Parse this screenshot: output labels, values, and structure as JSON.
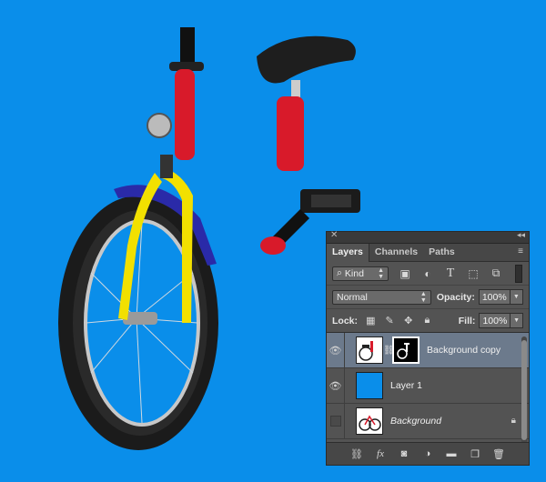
{
  "colors": {
    "background": "#0a8eea",
    "panel": "#535353",
    "selected_layer": "#6c7a8c"
  },
  "panel": {
    "close_glyph": "✕",
    "collapse_glyph": "◂◂",
    "tabs": [
      "Layers",
      "Channels",
      "Paths"
    ],
    "menu_glyph": "≡",
    "filter": {
      "kind_label": "Kind",
      "icons": [
        "image-filter-icon",
        "adjustment-filter-icon",
        "type-filter-icon",
        "shape-filter-icon",
        "smart-object-filter-icon"
      ]
    },
    "blend_mode": "Normal",
    "opacity_label": "Opacity:",
    "opacity_value": "100%",
    "lock_label": "Lock:",
    "fill_label": "Fill:",
    "fill_value": "100%",
    "layers": [
      {
        "name": "Background copy",
        "visible": true,
        "selected": true,
        "has_mask": true
      },
      {
        "name": "Layer 1",
        "visible": true,
        "selected": false,
        "fill": "#0a8eea"
      },
      {
        "name": "Background",
        "visible": false,
        "selected": false,
        "locked": true
      }
    ],
    "bottom_icons": [
      "link-layers-icon",
      "fx-icon",
      "add-mask-icon",
      "adjustment-layer-icon",
      "new-group-icon",
      "new-layer-icon",
      "delete-layer-icon"
    ],
    "fx_label": "fx"
  }
}
